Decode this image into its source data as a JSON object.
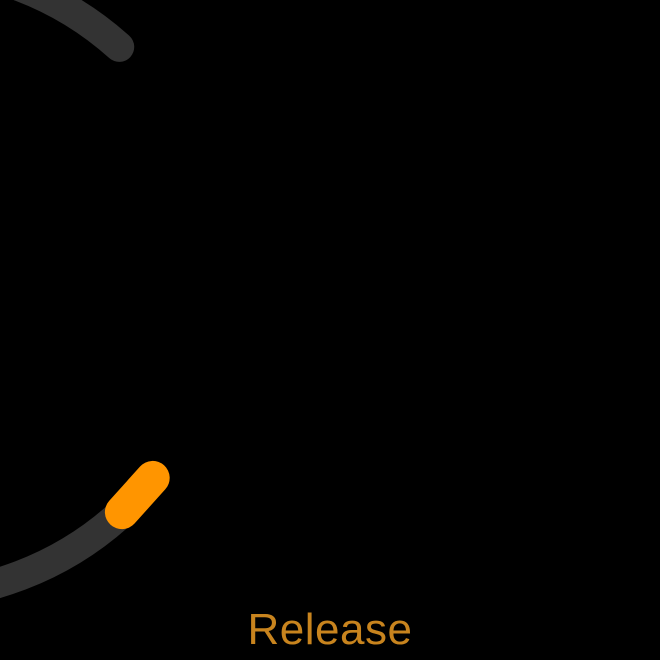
{
  "knob": {
    "label": "Release",
    "value_fraction": 0.0,
    "colors": {
      "track": "#333333",
      "indicator": "#FF9500",
      "label": "#C8841E",
      "background": "#000000"
    }
  }
}
